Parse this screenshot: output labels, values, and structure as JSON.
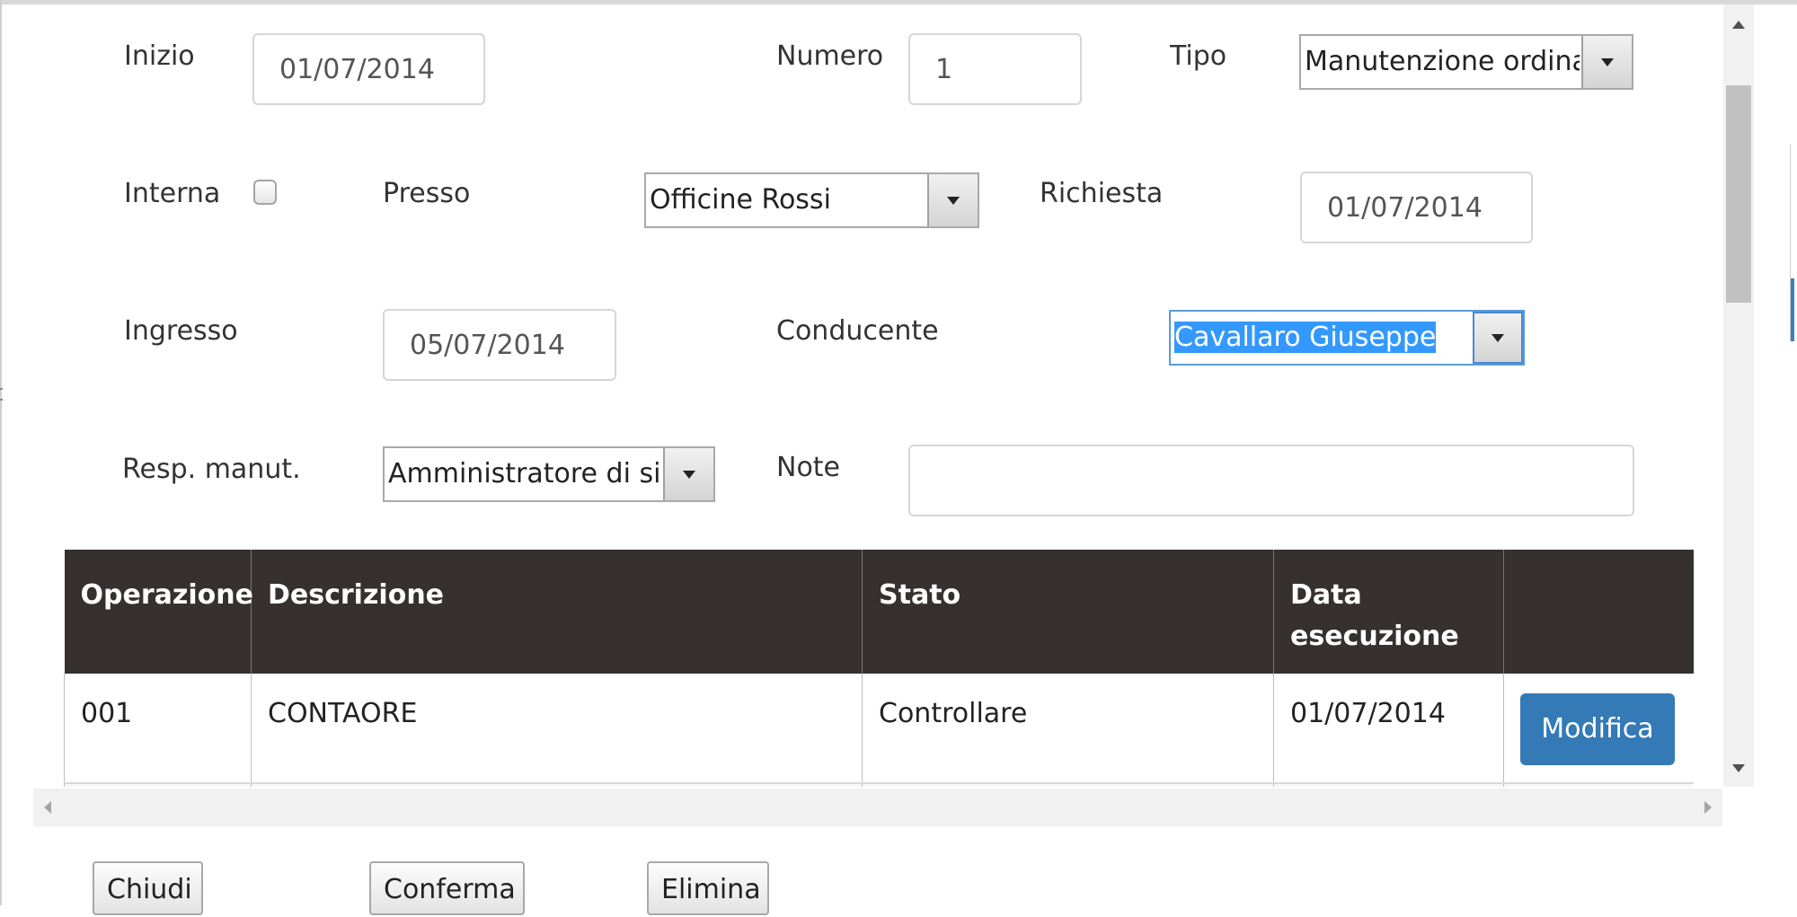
{
  "form": {
    "inizio": {
      "label": "Inizio",
      "value": "01/07/2014"
    },
    "numero": {
      "label": "Numero",
      "value": "1"
    },
    "tipo": {
      "label": "Tipo",
      "value": "Manutenzione ordinar"
    },
    "interna": {
      "label": "Interna",
      "checked": false
    },
    "presso": {
      "label": "Presso",
      "value": "Officine Rossi"
    },
    "richiesta": {
      "label": "Richiesta",
      "value": "01/07/2014"
    },
    "ingresso": {
      "label": "Ingresso",
      "value": "05/07/2014"
    },
    "conducente": {
      "label": "Conducente",
      "value": "Cavallaro  Giuseppe"
    },
    "resp_manut": {
      "label": "Resp. manut.",
      "value": "Amministratore di siste"
    },
    "note": {
      "label": "Note",
      "value": ""
    }
  },
  "table": {
    "columns": [
      "Operazione",
      "Descrizione",
      "Stato",
      "Data esecuzione",
      ""
    ],
    "rows": [
      {
        "operazione": "001",
        "descrizione": "CONTAORE",
        "stato": "Controllare",
        "data": "01/07/2014",
        "action": "Modifica"
      }
    ]
  },
  "buttons": {
    "chiudi": "Chiudi",
    "conferma": "Conferma",
    "elimina": "Elimina"
  },
  "colors": {
    "header_bg": "#36302f",
    "primary": "#337ab7",
    "selection": "#3399ff"
  },
  "icons": [
    "dropdown-arrow-icon",
    "scroll-up-icon",
    "scroll-down-icon",
    "scroll-left-icon",
    "scroll-right-icon",
    "resize-grip-icon"
  ]
}
